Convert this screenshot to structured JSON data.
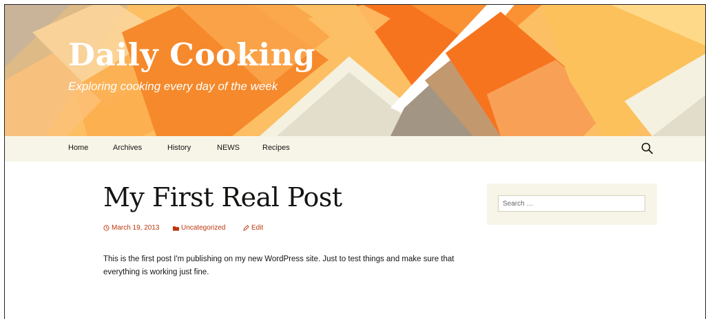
{
  "site": {
    "title": "Daily Cooking",
    "tagline": "Exploring cooking every day of the week"
  },
  "nav": {
    "items": [
      {
        "label": "Home"
      },
      {
        "label": "Archives"
      },
      {
        "label": "History"
      },
      {
        "label": "NEWS"
      },
      {
        "label": "Recipes"
      }
    ],
    "search_icon": "search-icon"
  },
  "post": {
    "title": "My First Real Post",
    "date": "March 19, 2013",
    "category": "Uncategorized",
    "edit_label": "Edit",
    "body": "This is the first post I'm publishing on my new WordPress site. Just to test things and make sure that everything is working just fine."
  },
  "sidebar": {
    "search_placeholder": "Search …"
  },
  "colors": {
    "accent": "#bc360a",
    "nav_bg": "#f7f5e7",
    "header_orange": "#f58a2c"
  }
}
